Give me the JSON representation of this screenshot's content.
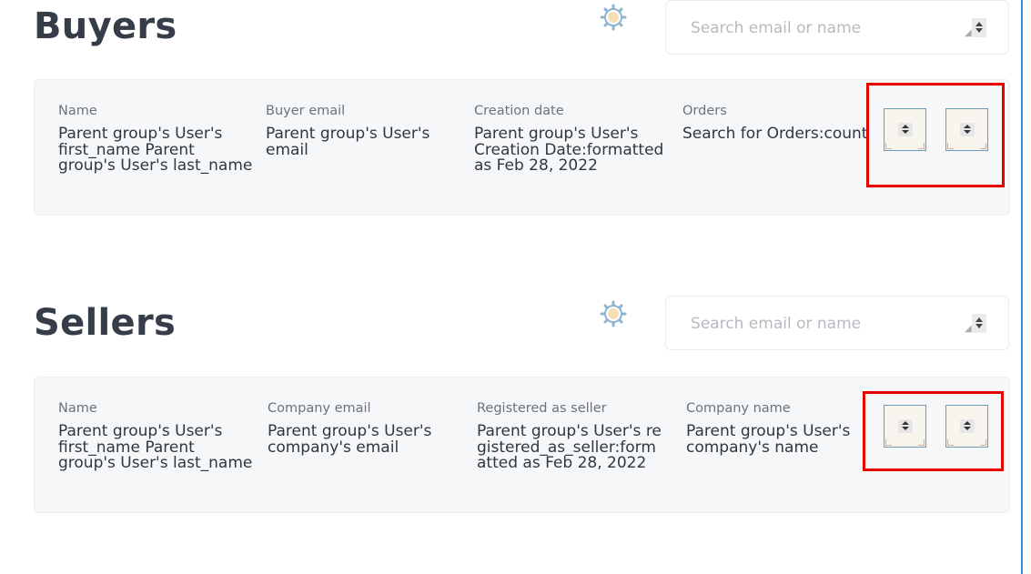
{
  "buyers": {
    "title": "Buyers",
    "search": {
      "placeholder": "Search email or name",
      "value": ""
    },
    "columns": [
      {
        "label": "Name",
        "value": "Parent group's User's first_name Parent group's User's last_name"
      },
      {
        "label": "Buyer email",
        "value": "Parent group's User's email"
      },
      {
        "label": "Creation date",
        "value": "Parent group's User's Creation Date:formatted as Feb 28, 2022"
      },
      {
        "label": "Orders",
        "value": "Search for Orders:count"
      }
    ]
  },
  "sellers": {
    "title": "Sellers",
    "search": {
      "placeholder": "Search email or name",
      "value": ""
    },
    "columns": [
      {
        "label": "Name",
        "value": "Parent group's User's first_name Parent group's User's last_name"
      },
      {
        "label": "Company email",
        "value": "Parent group's User's company's email"
      },
      {
        "label": "Registered as seller",
        "value": "Parent group's User's registered_as_seller:formatted as Feb 28, 2022"
      },
      {
        "label": "Company name",
        "value": "Parent group's User's company's name"
      }
    ]
  },
  "icons": {
    "settings": "gear-icon",
    "stepper": "up-down-stepper-icon",
    "resize": "resize-handle-icon"
  },
  "colors": {
    "title": "#343d48",
    "card_background": "#f6f7f9",
    "highlight": "#e80000",
    "right_guide": "#3b8fd6"
  }
}
